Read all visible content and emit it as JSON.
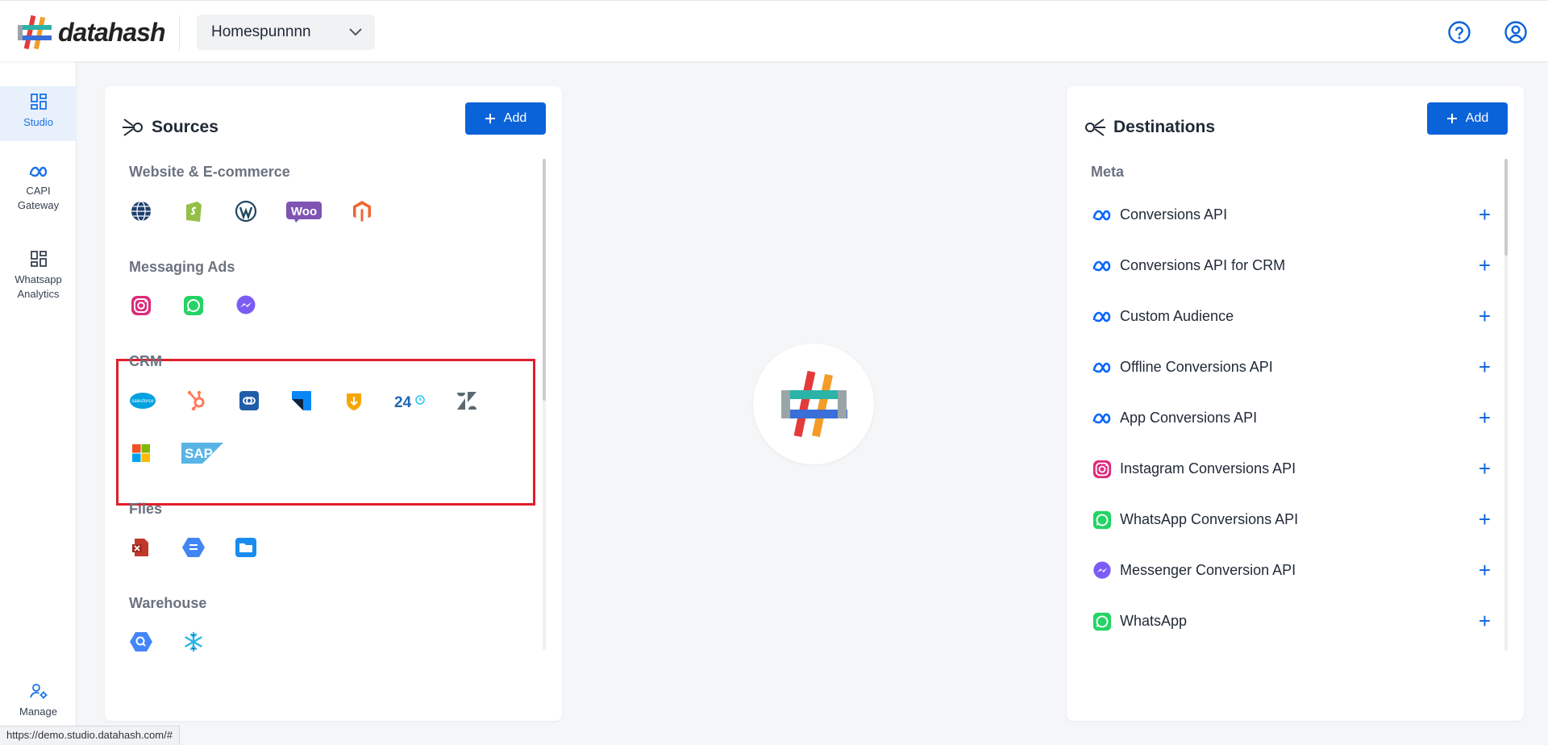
{
  "header": {
    "logo_text": "datahash",
    "workspace": "Homespunnnn",
    "icons": [
      "help-circle-icon",
      "user-circle-icon"
    ]
  },
  "sidenav": {
    "items": [
      {
        "label": "Studio",
        "icon": "dashboard-grid-icon",
        "active": true
      },
      {
        "label": "CAPI Gateway",
        "icon": "meta-infinity-icon"
      },
      {
        "label": "Whatsapp Analytics",
        "icon": "dashboard-grid-icon"
      },
      {
        "label": "Manage",
        "icon": "user-settings-icon"
      }
    ]
  },
  "sources": {
    "title": "Sources",
    "add_label": "Add",
    "sections": [
      {
        "title": "Website & E-commerce",
        "icons": [
          "globe-icon",
          "shopify-icon",
          "wordpress-icon",
          "woocommerce-icon",
          "magento-icon"
        ]
      },
      {
        "title": "Messaging Ads",
        "icons": [
          "instagram-icon",
          "whatsapp-icon",
          "messenger-icon"
        ]
      },
      {
        "title": "CRM",
        "icons": [
          "salesforce-icon",
          "hubspot-icon",
          "zoho-icon",
          "freshworks-icon",
          "pipedrive-icon",
          "bitrix24-icon",
          "zendesk-icon",
          "microsoft-icon",
          "sap-icon"
        ]
      },
      {
        "title": "Files",
        "icons": [
          "spreadsheet-icon",
          "google-sheets-icon",
          "folder-icon"
        ]
      },
      {
        "title": "Warehouse",
        "icons": [
          "bigquery-icon",
          "snowflake-icon"
        ]
      }
    ],
    "woo_text": "Woo",
    "bitrix_text": "24",
    "sap_text": "SAP"
  },
  "destinations": {
    "title": "Destinations",
    "add_label": "Add",
    "section_title": "Meta",
    "items": [
      {
        "label": "Conversions API",
        "icon": "meta-icon"
      },
      {
        "label": "Conversions API for CRM",
        "icon": "meta-icon"
      },
      {
        "label": "Custom Audience",
        "icon": "meta-icon"
      },
      {
        "label": "Offline Conversions API",
        "icon": "meta-icon"
      },
      {
        "label": "App Conversions API",
        "icon": "meta-icon"
      },
      {
        "label": "Instagram Conversions API",
        "icon": "instagram-icon"
      },
      {
        "label": "WhatsApp Conversions API",
        "icon": "whatsapp-icon"
      },
      {
        "label": "Messenger Conversion API",
        "icon": "messenger-icon"
      },
      {
        "label": "WhatsApp",
        "icon": "whatsapp-icon"
      }
    ]
  },
  "status_bar": {
    "url": "https://demo.studio.datahash.com/#"
  },
  "colors": {
    "accent": "#0b63d9",
    "highlight_box": "#e01e2b",
    "nav_active_bg": "#e8f0fc"
  }
}
